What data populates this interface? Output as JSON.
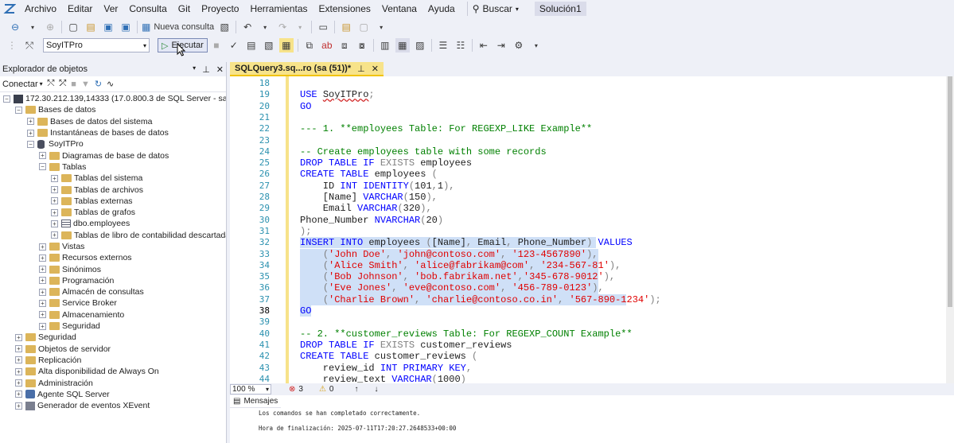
{
  "menu": [
    "Archivo",
    "Editar",
    "Ver",
    "Consulta",
    "Git",
    "Proyecto",
    "Herramientas",
    "Extensiones",
    "Ventana",
    "Ayuda"
  ],
  "search_label": "Buscar",
  "solution_name": "Solución1",
  "toolbar": {
    "new_query_label": "Nueva consulta",
    "database": "SoyITPro",
    "execute_label": "Ejecutar"
  },
  "object_explorer": {
    "title": "Explorador de objetos",
    "connect_label": "Conectar",
    "tree": [
      {
        "label": "172.30.212.139,14333 (17.0.800.3 de SQL Server - sa)",
        "indent": 0,
        "exp": "-",
        "icon": "server-icon"
      },
      {
        "label": "Bases de datos",
        "indent": 1,
        "exp": "-",
        "icon": "folder-icon"
      },
      {
        "label": "Bases de datos del sistema",
        "indent": 2,
        "exp": "+",
        "icon": "folder-icon"
      },
      {
        "label": "Instantáneas de bases de datos",
        "indent": 2,
        "exp": "+",
        "icon": "folder-icon"
      },
      {
        "label": "SoyITPro",
        "indent": 2,
        "exp": "-",
        "icon": "database-icon"
      },
      {
        "label": "Diagramas de base de datos",
        "indent": 3,
        "exp": "+",
        "icon": "folder-icon"
      },
      {
        "label": "Tablas",
        "indent": 3,
        "exp": "-",
        "icon": "folder-icon"
      },
      {
        "label": "Tablas del sistema",
        "indent": 4,
        "exp": "+",
        "icon": "folder-icon"
      },
      {
        "label": "Tablas de archivos",
        "indent": 4,
        "exp": "+",
        "icon": "folder-icon"
      },
      {
        "label": "Tablas externas",
        "indent": 4,
        "exp": "+",
        "icon": "folder-icon"
      },
      {
        "label": "Tablas de grafos",
        "indent": 4,
        "exp": "+",
        "icon": "folder-icon"
      },
      {
        "label": "dbo.employees",
        "indent": 4,
        "exp": "+",
        "icon": "table-icon"
      },
      {
        "label": "Tablas de libro de contabilidad descartadas",
        "indent": 4,
        "exp": "+",
        "icon": "folder-icon"
      },
      {
        "label": "Vistas",
        "indent": 3,
        "exp": "+",
        "icon": "folder-icon"
      },
      {
        "label": "Recursos externos",
        "indent": 3,
        "exp": "+",
        "icon": "folder-icon"
      },
      {
        "label": "Sinónimos",
        "indent": 3,
        "exp": "+",
        "icon": "folder-icon"
      },
      {
        "label": "Programación",
        "indent": 3,
        "exp": "+",
        "icon": "folder-icon"
      },
      {
        "label": "Almacén de consultas",
        "indent": 3,
        "exp": "+",
        "icon": "folder-icon"
      },
      {
        "label": "Service Broker",
        "indent": 3,
        "exp": "+",
        "icon": "folder-icon"
      },
      {
        "label": "Almacenamiento",
        "indent": 3,
        "exp": "+",
        "icon": "folder-icon"
      },
      {
        "label": "Seguridad",
        "indent": 3,
        "exp": "+",
        "icon": "folder-icon"
      },
      {
        "label": "Seguridad",
        "indent": 1,
        "exp": "+",
        "icon": "folder-icon"
      },
      {
        "label": "Objetos de servidor",
        "indent": 1,
        "exp": "+",
        "icon": "folder-icon"
      },
      {
        "label": "Replicación",
        "indent": 1,
        "exp": "+",
        "icon": "folder-icon"
      },
      {
        "label": "Alta disponibilidad de Always On",
        "indent": 1,
        "exp": "+",
        "icon": "folder-icon"
      },
      {
        "label": "Administración",
        "indent": 1,
        "exp": "+",
        "icon": "folder-icon"
      },
      {
        "label": "Agente SQL Server",
        "indent": 1,
        "exp": "+",
        "icon": "agent-icon"
      },
      {
        "label": "Generador de eventos XEvent",
        "indent": 1,
        "exp": "+",
        "icon": "xevent-icon"
      }
    ]
  },
  "editor": {
    "tab_title": "SQLQuery3.sq...ro (sa (51))*",
    "current_line": 38,
    "lines": [
      {
        "n": 18,
        "t": []
      },
      {
        "n": 19,
        "t": [
          [
            "kw",
            "USE "
          ],
          [
            "",
            "SoyITPro"
          ],
          [
            "gr",
            ";"
          ]
        ]
      },
      {
        "n": 20,
        "t": [
          [
            "kw",
            "GO"
          ]
        ]
      },
      {
        "n": 21,
        "t": []
      },
      {
        "n": 22,
        "t": [
          [
            "cm",
            "--- 1. **employees Table: For REGEXP_LIKE Example**"
          ]
        ]
      },
      {
        "n": 23,
        "t": []
      },
      {
        "n": 24,
        "t": [
          [
            "cm",
            "-- Create employees table with some records"
          ]
        ]
      },
      {
        "n": 25,
        "t": [
          [
            "kw",
            "DROP TABLE IF "
          ],
          [
            "gr",
            "EXISTS "
          ],
          [
            "",
            "employees"
          ]
        ]
      },
      {
        "n": 26,
        "t": [
          [
            "kw",
            "CREATE TABLE "
          ],
          [
            "",
            "employees "
          ],
          [
            "gr",
            "("
          ]
        ]
      },
      {
        "n": 27,
        "t": [
          [
            "",
            "    ID "
          ],
          [
            "kw",
            "INT IDENTITY"
          ],
          [
            "gr",
            "("
          ],
          [
            "",
            "101"
          ],
          [
            "gr",
            ","
          ],
          [
            "",
            "1"
          ],
          [
            "gr",
            "),"
          ]
        ]
      },
      {
        "n": 28,
        "t": [
          [
            "",
            "    [Name] "
          ],
          [
            "kw",
            "VARCHAR"
          ],
          [
            "gr",
            "("
          ],
          [
            "",
            "150"
          ],
          [
            "gr",
            "),"
          ]
        ]
      },
      {
        "n": 29,
        "t": [
          [
            "",
            "    Email "
          ],
          [
            "kw",
            "VARCHAR"
          ],
          [
            "gr",
            "("
          ],
          [
            "",
            "320"
          ],
          [
            "gr",
            "),"
          ]
        ]
      },
      {
        "n": 30,
        "t": [
          [
            "",
            ""
          ],
          [
            "",
            ""
          ],
          [
            "",
            "Phone_Number "
          ],
          [
            "kw",
            "NVARCHAR"
          ],
          [
            "gr",
            "("
          ],
          [
            "",
            "20"
          ],
          [
            "gr",
            ")"
          ]
        ]
      },
      {
        "n": 31,
        "t": [
          [
            "gr",
            ");"
          ]
        ]
      },
      {
        "n": 32,
        "t": [
          [
            "kw",
            "INSERT INTO "
          ],
          [
            "",
            "employees "
          ],
          [
            "gr",
            "("
          ],
          [
            "",
            "[Name]"
          ],
          [
            "gr",
            ", "
          ],
          [
            "",
            "Email"
          ],
          [
            "gr",
            ", "
          ],
          [
            "",
            "Phone_Number"
          ],
          [
            "gr",
            ") "
          ],
          [
            "kw",
            "VALUES"
          ]
        ]
      },
      {
        "n": 33,
        "t": [
          [
            "",
            "    "
          ],
          [
            "gr",
            "("
          ],
          [
            "str",
            "'John Doe'"
          ],
          [
            "gr",
            ", "
          ],
          [
            "str",
            "'john@contoso.com'"
          ],
          [
            "gr",
            ", "
          ],
          [
            "str",
            "'123-4567890'"
          ],
          [
            "gr",
            "),"
          ]
        ]
      },
      {
        "n": 34,
        "t": [
          [
            "",
            "    "
          ],
          [
            "gr",
            "("
          ],
          [
            "str",
            "'Alice Smith'"
          ],
          [
            "gr",
            ", "
          ],
          [
            "str",
            "'alice@fabrikam@com'"
          ],
          [
            "gr",
            ", "
          ],
          [
            "str",
            "'234-567-81'"
          ],
          [
            "gr",
            "),"
          ]
        ]
      },
      {
        "n": 35,
        "t": [
          [
            "",
            "    "
          ],
          [
            "gr",
            "("
          ],
          [
            "str",
            "'Bob Johnson'"
          ],
          [
            "gr",
            ", "
          ],
          [
            "str",
            "'bob.fabrikam.net'"
          ],
          [
            "gr",
            ","
          ],
          [
            "str",
            "'345-678-9012'"
          ],
          [
            "gr",
            "),"
          ]
        ]
      },
      {
        "n": 36,
        "t": [
          [
            "",
            "    "
          ],
          [
            "gr",
            "("
          ],
          [
            "str",
            "'Eve Jones'"
          ],
          [
            "gr",
            ", "
          ],
          [
            "str",
            "'eve@contoso.com'"
          ],
          [
            "gr",
            ", "
          ],
          [
            "str",
            "'456-789-0123'"
          ],
          [
            "gr",
            "),"
          ]
        ]
      },
      {
        "n": 37,
        "t": [
          [
            "",
            "    "
          ],
          [
            "gr",
            "("
          ],
          [
            "str",
            "'Charlie Brown'"
          ],
          [
            "gr",
            ", "
          ],
          [
            "str",
            "'charlie@contoso.co.in'"
          ],
          [
            "gr",
            ", "
          ],
          [
            "str",
            "'567-890-1234'"
          ],
          [
            "gr",
            ");"
          ]
        ]
      },
      {
        "n": 38,
        "t": [
          [
            "kw",
            "GO"
          ]
        ]
      },
      {
        "n": 39,
        "t": []
      },
      {
        "n": 40,
        "t": [
          [
            "cm",
            "-- 2. **customer_reviews Table: For REGEXP_COUNT Example**"
          ]
        ]
      },
      {
        "n": 41,
        "t": [
          [
            "kw",
            "DROP TABLE IF "
          ],
          [
            "gr",
            "EXISTS "
          ],
          [
            "",
            "customer_reviews"
          ]
        ]
      },
      {
        "n": 42,
        "t": [
          [
            "kw",
            "CREATE TABLE "
          ],
          [
            "",
            "customer_reviews "
          ],
          [
            "gr",
            "("
          ]
        ]
      },
      {
        "n": 43,
        "t": [
          [
            "",
            "    review_id "
          ],
          [
            "kw",
            "INT PRIMARY KEY"
          ],
          [
            "gr",
            ","
          ]
        ]
      },
      {
        "n": 44,
        "t": [
          [
            "",
            "    review_text "
          ],
          [
            "kw",
            "VARCHAR"
          ],
          [
            "gr",
            "("
          ],
          [
            "",
            "1000"
          ],
          [
            "gr",
            ")"
          ]
        ]
      }
    ]
  },
  "status": {
    "zoom": "100 %",
    "errors": "3",
    "warnings": "0"
  },
  "results": {
    "tab_label": "Mensajes",
    "messages": [
      "Los comandos se han completado correctamente.",
      "Hora de finalización: 2025-07-11T17:20:27.2648533+00:00"
    ]
  }
}
